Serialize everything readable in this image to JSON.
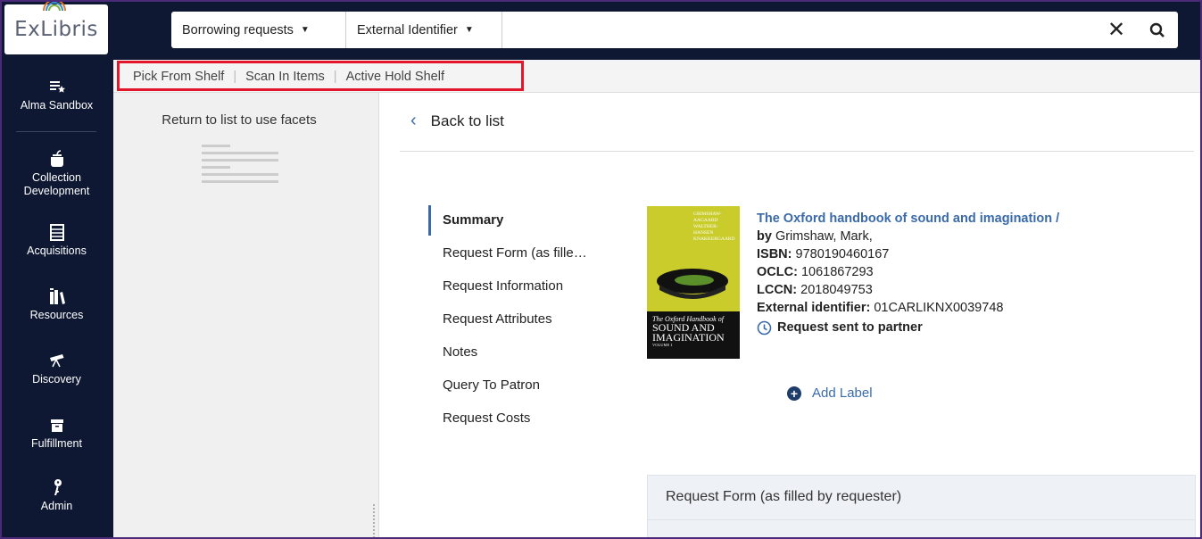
{
  "app": {
    "logo_text": "ExLibris"
  },
  "colors": {
    "nav_bg": "#0e1833",
    "accent": "#3a6aa8",
    "highlight": "#e3172b"
  },
  "leftnav": {
    "items": [
      {
        "label": "Alma Sandbox",
        "icon": "list-star-icon"
      },
      {
        "label": "Collection Development",
        "icon": "apple-icon"
      },
      {
        "label": "Acquisitions",
        "icon": "abacus-icon"
      },
      {
        "label": "Resources",
        "icon": "books-icon"
      },
      {
        "label": "Discovery",
        "icon": "telescope-icon"
      },
      {
        "label": "Fulfillment",
        "icon": "archive-icon"
      },
      {
        "label": "Admin",
        "icon": "key-icon"
      }
    ]
  },
  "search": {
    "scope": "Borrowing requests",
    "field": "External Identifier",
    "value": "",
    "clear_icon": "close-icon",
    "search_icon": "search-icon"
  },
  "subbar": {
    "links": [
      "Pick From Shelf",
      "Scan In Items",
      "Active Hold Shelf"
    ]
  },
  "facets": {
    "message": "Return to list to use facets"
  },
  "main": {
    "back_label": "Back to list",
    "toc": [
      "Summary",
      "Request Form (as fille…",
      "Request Information",
      "Request Attributes",
      "Notes",
      "Query To Patron",
      "Request Costs"
    ],
    "cover": {
      "authors": [
        "GRIMSHAW-",
        "AAGAARD",
        "WALTHER-",
        "HANSEN",
        "KNAKKERGAARD"
      ],
      "title_line1": "The Oxford Handbook of",
      "title_line2": "SOUND AND",
      "title_line3": "IMAGINATION",
      "volume": "VOLUME 1"
    },
    "record": {
      "title": "The Oxford handbook of sound and imagination /",
      "by_label": "by",
      "author": "Grimshaw, Mark,",
      "isbn_label": "ISBN:",
      "isbn": "9780190460167",
      "oclc_label": "OCLC:",
      "oclc": "1061867293",
      "lccn_label": "LCCN:",
      "lccn": "2018049753",
      "extid_label": "External identifier:",
      "extid": "01CARLIKNX0039748",
      "status": "Request sent to partner",
      "add_label": "Add Label"
    },
    "section_title": "Request Form (as filled by requester)"
  }
}
